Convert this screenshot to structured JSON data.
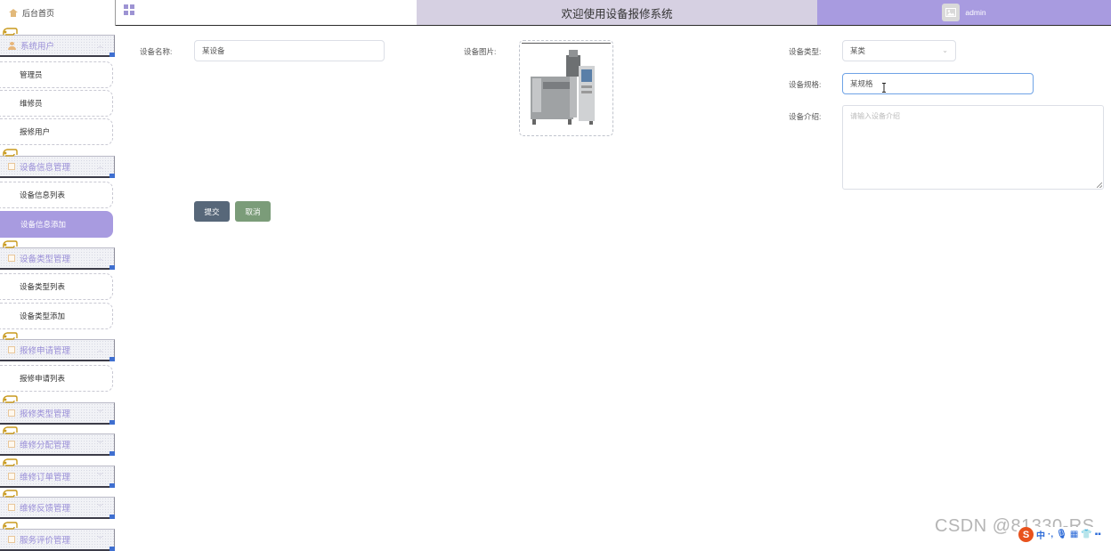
{
  "header": {
    "home_tab": "后台首页",
    "system_title": "欢迎使用设备报修系统",
    "username": "admin"
  },
  "sidebar": {
    "groups": [
      {
        "label": "系统用户",
        "icon": "user-icon"
      },
      {
        "label": "设备信息管理",
        "icon": "folder-icon"
      },
      {
        "label": "设备类型管理",
        "icon": "folder-icon"
      },
      {
        "label": "报修申请管理",
        "icon": "folder-icon"
      },
      {
        "label": "报修类型管理",
        "icon": "folder-icon"
      },
      {
        "label": "维修分配管理",
        "icon": "folder-icon"
      },
      {
        "label": "维修订单管理",
        "icon": "folder-icon"
      },
      {
        "label": "维修反馈管理",
        "icon": "folder-icon"
      },
      {
        "label": "服务评价管理",
        "icon": "folder-icon"
      }
    ],
    "items": [
      {
        "label": "管理员"
      },
      {
        "label": "维修员"
      },
      {
        "label": "报修用户"
      },
      {
        "label": "设备信息列表"
      },
      {
        "label": "设备信息添加",
        "active": true
      },
      {
        "label": "设备类型列表"
      },
      {
        "label": "设备类型添加"
      },
      {
        "label": "报修申请列表"
      }
    ]
  },
  "form": {
    "name_label": "设备名称:",
    "name_value": "某设备",
    "image_label": "设备图片:",
    "type_label": "设备类型:",
    "type_value": "某类",
    "spec_label": "设备规格:",
    "spec_value": "某规格",
    "intro_label": "设备介绍:",
    "intro_placeholder": "请输入设备介绍",
    "submit_label": "提交",
    "cancel_label": "取消"
  },
  "watermark": "CSDN @81330-RS",
  "tray": {
    "ime_label": "中"
  },
  "colors": {
    "accent": "#a89be0",
    "title_bar": "#d6d0e2",
    "submit": "#576779",
    "cancel": "#7b9c79"
  }
}
